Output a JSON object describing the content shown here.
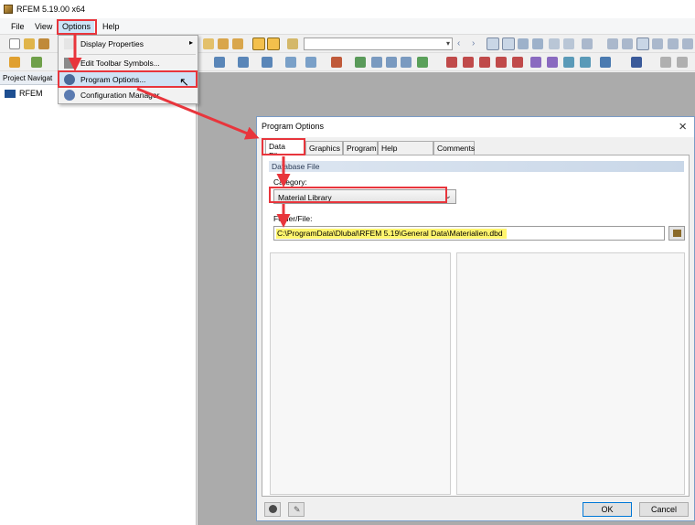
{
  "window": {
    "title": "RFEM 5.19.00 x64"
  },
  "menubar": {
    "items": [
      "File",
      "View",
      "Options",
      "Help"
    ]
  },
  "options_menu": {
    "items": [
      {
        "label": "Display Properties",
        "icon": "display-properties-icon",
        "submenu": true
      },
      {
        "label": "Edit Toolbar Symbols...",
        "icon": "toolbar-edit-icon",
        "submenu": false
      },
      {
        "label": "Program Options...",
        "icon": "program-options-icon",
        "submenu": false
      },
      {
        "label": "Configuration Manager",
        "icon": "configuration-manager-icon",
        "submenu": false
      }
    ]
  },
  "navigator": {
    "title": "Project Navigat",
    "root_item": "RFEM"
  },
  "dialog": {
    "title": "Program Options",
    "tabs": [
      "Data Files",
      "Graphics",
      "Program",
      "Help Assistant",
      "Comments"
    ],
    "active_tab": "Data Files",
    "group_title": "Database File",
    "category_label": "Category:",
    "category_value": "Material Library",
    "folder_label": "Folder/File:",
    "folder_value": "C:\\ProgramData\\Dlubal\\RFEM 5.19\\General Data\\Materialien.dbd",
    "ok_label": "OK",
    "cancel_label": "Cancel"
  },
  "annotations": {
    "highlight_color": "#e8353c",
    "path_highlight": "#fff56e"
  }
}
